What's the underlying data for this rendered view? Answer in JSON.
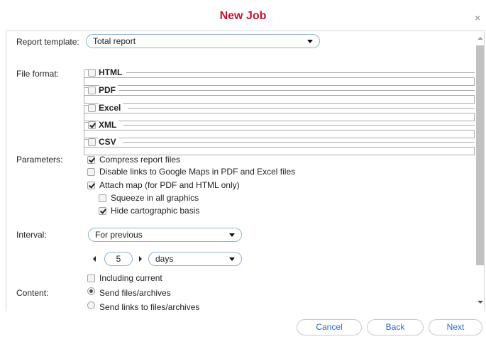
{
  "dialog": {
    "title": "New Job",
    "close_glyph": "×"
  },
  "labels": {
    "report_template": "Report template:",
    "file_format": "File format:",
    "parameters": "Parameters:",
    "interval": "Interval:",
    "content": "Content:"
  },
  "report_template": {
    "value": "Total report"
  },
  "formats": [
    {
      "label": "HTML",
      "checked": false
    },
    {
      "label": "PDF",
      "checked": false
    },
    {
      "label": "Excel",
      "checked": false
    },
    {
      "label": "XML",
      "checked": true
    },
    {
      "label": "CSV",
      "checked": false
    }
  ],
  "parameters": [
    {
      "label": "Compress report files",
      "checked": true
    },
    {
      "label": "Disable links to Google Maps in PDF and Excel files",
      "checked": false
    },
    {
      "label": "Attach map (for PDF and HTML only)",
      "checked": true
    },
    {
      "label": "Squeeze in all graphics",
      "checked": false
    },
    {
      "label": "Hide cartographic basis",
      "checked": true
    }
  ],
  "interval": {
    "mode": "For previous",
    "count": "5",
    "unit": "days",
    "including_current": {
      "label": "Including current",
      "checked": false
    }
  },
  "content": [
    {
      "label": "Send files/archives",
      "selected": true
    },
    {
      "label": "Send links to files/archives",
      "selected": false
    }
  ],
  "buttons": {
    "cancel": "Cancel",
    "back": "Back",
    "next": "Next"
  },
  "colors": {
    "title": "#c8102e",
    "button_text": "#2a6cc4",
    "select_border": "#8fb3d9"
  }
}
